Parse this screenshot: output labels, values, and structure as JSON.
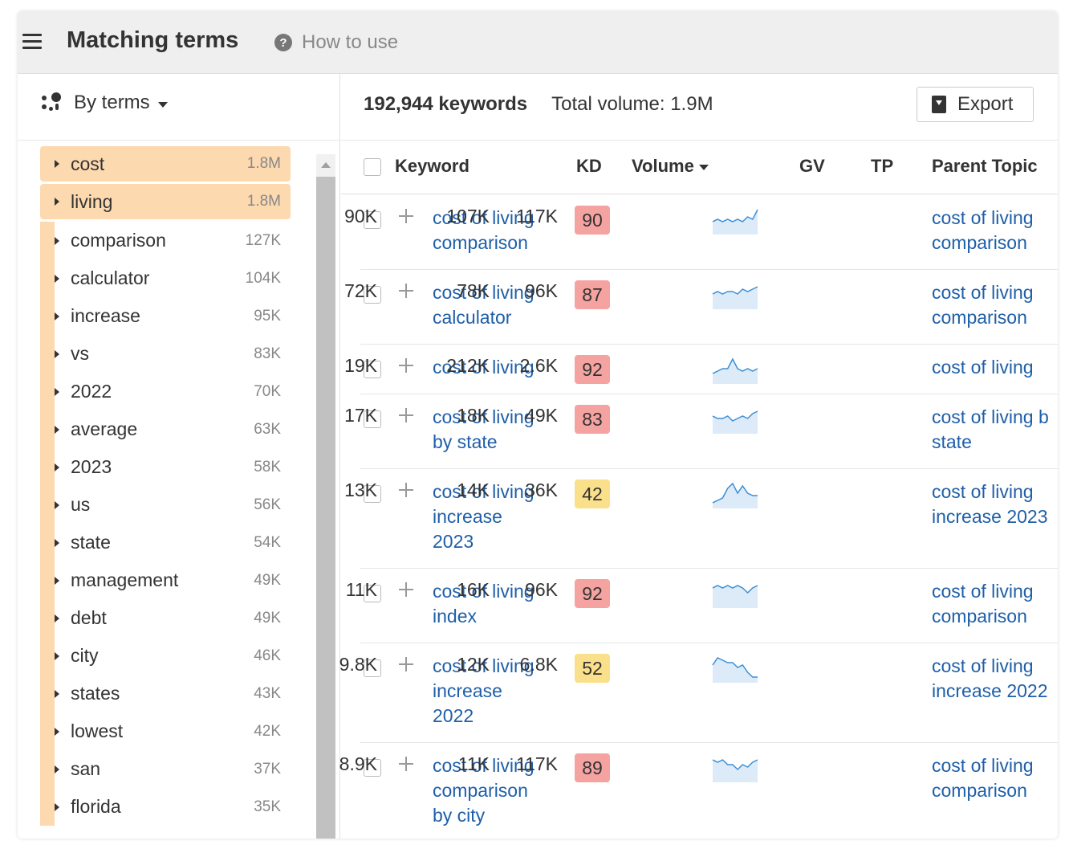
{
  "header": {
    "title": "Matching terms",
    "how_to_use": "How to use"
  },
  "sidebar": {
    "mode_label": "By terms",
    "terms": [
      {
        "label": "cost",
        "count": "1.8M",
        "highlighted": true
      },
      {
        "label": "living",
        "count": "1.8M",
        "highlighted": true
      },
      {
        "label": "comparison",
        "count": "127K"
      },
      {
        "label": "calculator",
        "count": "104K"
      },
      {
        "label": "increase",
        "count": "95K"
      },
      {
        "label": "vs",
        "count": "83K"
      },
      {
        "label": "2022",
        "count": "70K"
      },
      {
        "label": "average",
        "count": "63K"
      },
      {
        "label": "2023",
        "count": "58K"
      },
      {
        "label": "us",
        "count": "56K"
      },
      {
        "label": "state",
        "count": "54K"
      },
      {
        "label": "management",
        "count": "49K"
      },
      {
        "label": "debt",
        "count": "49K"
      },
      {
        "label": "city",
        "count": "46K"
      },
      {
        "label": "states",
        "count": "43K"
      },
      {
        "label": "lowest",
        "count": "42K"
      },
      {
        "label": "san",
        "count": "37K"
      },
      {
        "label": "florida",
        "count": "35K"
      }
    ]
  },
  "summary": {
    "keywords": "192,944 keywords",
    "total_volume": "Total volume: 1.9M",
    "export_label": "Export"
  },
  "table": {
    "headers": {
      "keyword": "Keyword",
      "kd": "KD",
      "volume": "Volume",
      "gv": "GV",
      "tp": "TP",
      "parent_topic": "Parent Topic"
    },
    "rows": [
      {
        "keyword": [
          "cost of living",
          "comparison"
        ],
        "kd": "90",
        "kd_level": "red",
        "volume": "90K",
        "gv": "107K",
        "tp": "117K",
        "parent": [
          "cost of living",
          "comparison"
        ],
        "trend": [
          6,
          5,
          6,
          5,
          6,
          5,
          6,
          4,
          5,
          1
        ]
      },
      {
        "keyword": [
          "cost of living",
          "calculator"
        ],
        "kd": "87",
        "kd_level": "red",
        "volume": "72K",
        "gv": "78K",
        "tp": "96K",
        "parent": [
          "cost of living",
          "comparison"
        ],
        "trend": [
          5,
          4,
          5,
          4,
          4,
          5,
          3,
          4,
          3,
          2
        ]
      },
      {
        "keyword": [
          "cost of living"
        ],
        "kd": "92",
        "kd_level": "red",
        "volume": "19K",
        "gv": "212K",
        "tp": "2.6K",
        "parent": [
          "cost of living"
        ],
        "trend": [
          7,
          6,
          5,
          5,
          1,
          5,
          6,
          5,
          6,
          5
        ]
      },
      {
        "keyword": [
          "cost of living",
          "by state"
        ],
        "kd": "83",
        "kd_level": "red",
        "volume": "17K",
        "gv": "18K",
        "tp": "49K",
        "parent": [
          "cost of living b",
          "state"
        ],
        "trend": [
          4,
          5,
          5,
          4,
          6,
          5,
          4,
          5,
          3,
          2
        ]
      },
      {
        "keyword": [
          "cost of living",
          "increase",
          "2023"
        ],
        "kd": "42",
        "kd_level": "yellow",
        "volume": "13K",
        "gv": "14K",
        "tp": "36K",
        "parent": [
          "cost of living",
          "increase 2023"
        ],
        "trend": [
          9,
          8,
          7,
          3,
          1,
          5,
          2,
          5,
          6,
          6
        ]
      },
      {
        "keyword": [
          "cost of living",
          "index"
        ],
        "kd": "92",
        "kd_level": "red",
        "volume": "11K",
        "gv": "16K",
        "tp": "96K",
        "parent": [
          "cost of living",
          "comparison"
        ],
        "trend": [
          3,
          2,
          3,
          2,
          3,
          2,
          3,
          5,
          3,
          2
        ]
      },
      {
        "keyword": [
          "cost of living",
          "increase",
          "2022"
        ],
        "kd": "52",
        "kd_level": "yellow",
        "volume": "9.8K",
        "gv": "12K",
        "tp": "6.8K",
        "parent": [
          "cost of living",
          "increase 2022"
        ],
        "trend": [
          4,
          1,
          2,
          3,
          3,
          5,
          4,
          7,
          9,
          9
        ]
      },
      {
        "keyword": [
          "cost of living",
          "comparison",
          "by city"
        ],
        "kd": "89",
        "kd_level": "red",
        "volume": "8.9K",
        "gv": "11K",
        "tp": "117K",
        "parent": [
          "cost of living",
          "comparison"
        ],
        "trend": [
          2,
          3,
          2,
          4,
          4,
          6,
          4,
          5,
          3,
          2
        ]
      }
    ]
  },
  "colors": {
    "accent_link": "#1f5fa8",
    "term_highlight": "#fdd9b0",
    "kd_red": "#f5a3a1",
    "kd_yellow": "#fbe08b",
    "sparkline": "#3b8fd6"
  }
}
